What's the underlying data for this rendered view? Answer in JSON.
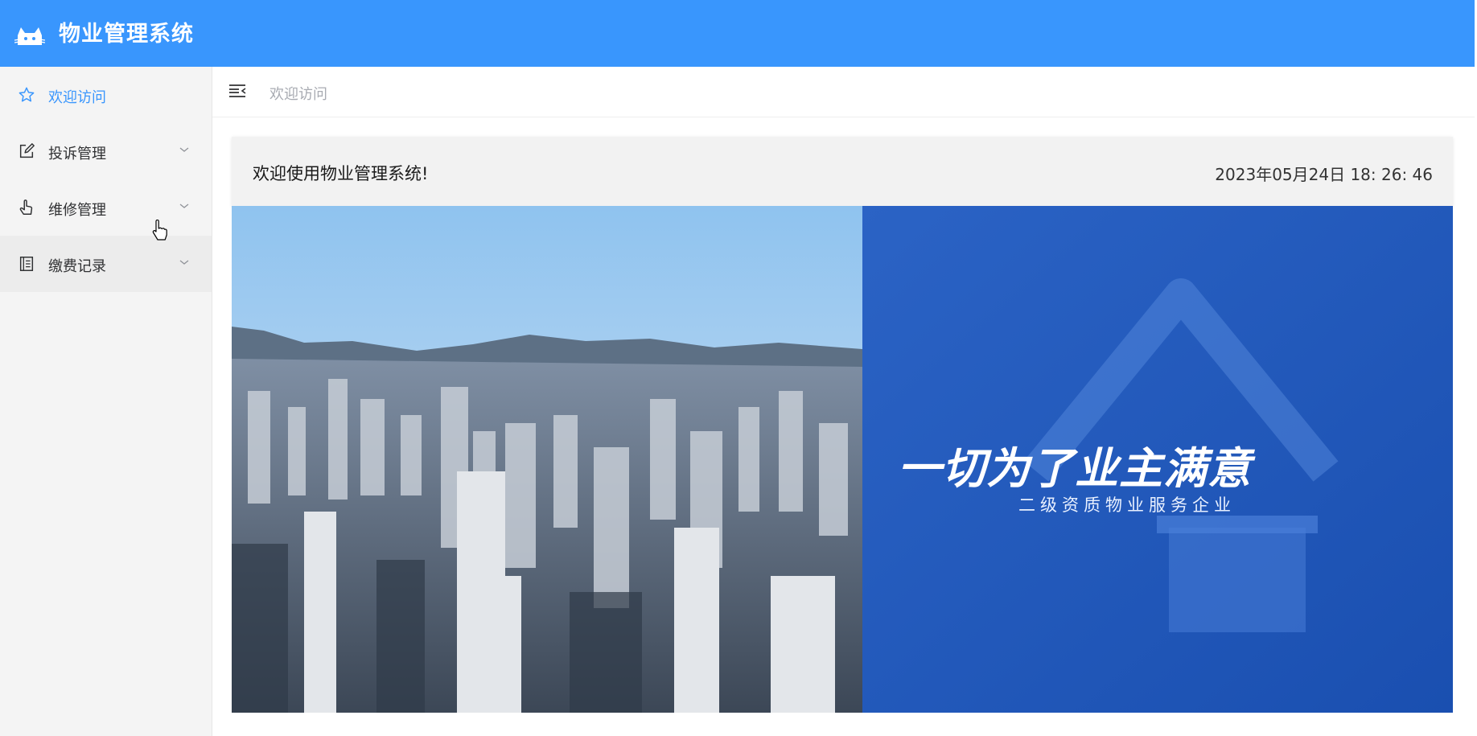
{
  "header": {
    "title": "物业管理系统",
    "logo_icon": "cat-logo-icon",
    "background": "#3996fd"
  },
  "sidebar": {
    "items": [
      {
        "label": "欢迎访问",
        "icon": "star-icon",
        "active": true
      },
      {
        "label": "投诉管理",
        "icon": "edit-icon",
        "expandable": true
      },
      {
        "label": "维修管理",
        "icon": "hand-pointer-icon",
        "expandable": true
      },
      {
        "label": "缴费记录",
        "icon": "document-icon",
        "expandable": true
      }
    ]
  },
  "topbar": {
    "toggle_icon": "menu-fold-icon",
    "breadcrumb": "欢迎访问"
  },
  "main": {
    "welcome_text": "欢迎使用物业管理系统!",
    "datetime": "2023年05月24日 18: 26: 46",
    "banner": {
      "slogan": "一切为了业主满意",
      "subtitle": "二级资质物业服务企业"
    }
  },
  "colors": {
    "accent": "#3996fd",
    "sidebar_bg": "#f4f4f4"
  }
}
